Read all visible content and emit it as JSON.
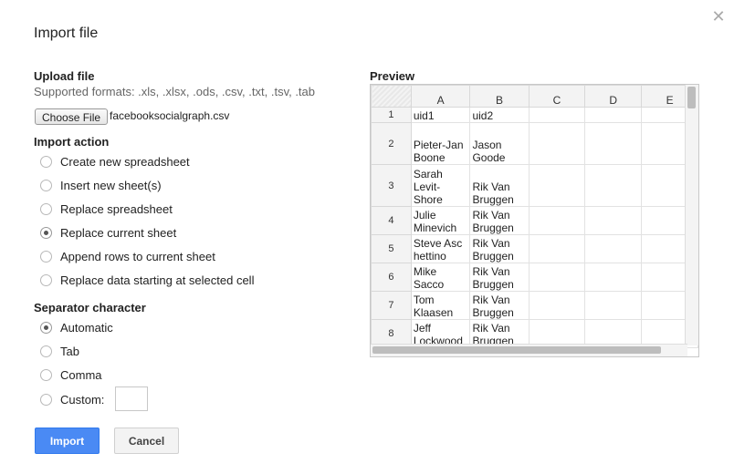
{
  "dialog": {
    "title": "Import file",
    "close_icon": "close-icon"
  },
  "upload": {
    "heading": "Upload file",
    "supported": "Supported formats: .xls, .xlsx, .ods, .csv, .txt, .tsv, .tab",
    "choose_label": "Choose File",
    "file_name": "facebooksocialgraph.csv"
  },
  "import_action": {
    "heading": "Import action",
    "options": [
      {
        "label": "Create new spreadsheet",
        "selected": false
      },
      {
        "label": "Insert new sheet(s)",
        "selected": false
      },
      {
        "label": "Replace spreadsheet",
        "selected": false
      },
      {
        "label": "Replace current sheet",
        "selected": true
      },
      {
        "label": "Append rows to current sheet",
        "selected": false
      },
      {
        "label": "Replace data starting at selected cell",
        "selected": false
      }
    ]
  },
  "separator": {
    "heading": "Separator character",
    "options": [
      {
        "label": "Automatic",
        "selected": true
      },
      {
        "label": "Tab",
        "selected": false
      },
      {
        "label": "Comma",
        "selected": false
      },
      {
        "label": "Custom:",
        "selected": false
      }
    ],
    "custom_value": ""
  },
  "buttons": {
    "import": "Import",
    "cancel": "Cancel",
    "import_color": "#4a8af4"
  },
  "preview": {
    "heading": "Preview",
    "columns": [
      "A",
      "B",
      "C",
      "D",
      "E"
    ],
    "rows": [
      {
        "num": "1",
        "a": "uid1",
        "b": "uid2"
      },
      {
        "num": "2",
        "a": "Pieter-Jan Boone",
        "b": "Jason Goode"
      },
      {
        "num": "3",
        "a": "Sarah Levit-Shore",
        "b": "Rik Van Bruggen"
      },
      {
        "num": "4",
        "a": "Julie Minevich",
        "b": "Rik Van Bruggen"
      },
      {
        "num": "5",
        "a": "Steve Aschettino",
        "b": "Rik Van Bruggen"
      },
      {
        "num": "6",
        "a": "Mike Sacco",
        "b": "Rik Van Bruggen"
      },
      {
        "num": "7",
        "a": "Tom Klaasen",
        "b": "Rik Van Bruggen"
      },
      {
        "num": "8",
        "a": "Jeff Lockwood",
        "b": "Rik Van Bruggen"
      }
    ]
  }
}
